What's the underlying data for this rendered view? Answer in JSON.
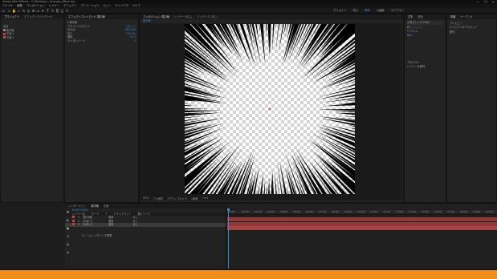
{
  "window": {
    "title": "Adobe After Effects - C:\\Desktop\\...\\manga_effect.aep",
    "controls": [
      "—",
      "❐",
      "✕"
    ]
  },
  "menu": [
    "ファイル",
    "編集",
    "コンポジション",
    "レイヤー",
    "エフェクト",
    "アニメーション",
    "ビュー",
    "ウィンドウ",
    "ヘルプ"
  ],
  "toolbar": {
    "workspaces": [
      "デフォルト",
      "学ぶ",
      "標準",
      "小画面",
      "ライブラリ"
    ],
    "active_workspace": "標準"
  },
  "project_panel": {
    "tabs": [
      "プロジェクト",
      "エフェクトコントロール"
    ],
    "items": [
      "名前",
      "集中線",
      "平面 1",
      "平面 2"
    ]
  },
  "effect_panel": {
    "tabs": [
      "エフェクトコントロール 集中線"
    ],
    "rows": [
      {
        "label": "集中線",
        "value": ""
      },
      {
        "label": "ブラインドカウント",
        "value": "リセット"
      },
      {
        "label": "中心点",
        "value": "960,540"
      },
      {
        "label": "長さ",
        "value": "100.0%"
      },
      {
        "label": "線幅",
        "value": "50.0"
      },
      {
        "label": "ランダムシード",
        "value": "0"
      }
    ]
  },
  "comp_panel": {
    "tabs": [
      "コンポジション 集中線",
      "レイヤー (なし)",
      "フッテージ (なし)"
    ],
    "breadcrumb": "集中線",
    "viewer_bar": [
      "50%",
      "フル画質",
      "アクティブカメラ",
      "1画面",
      "+0.0"
    ]
  },
  "right_panel": {
    "tabs": [
      "情報",
      "オーディオ",
      "プレビュー",
      "エフェクト&プリセット",
      "文字",
      "段落",
      "整列"
    ],
    "font": "小塚ゴシック Pr6N",
    "style": "M",
    "size": "100 px",
    "tracking": "0",
    "properties_title": "プロパティ",
    "align_label": "レイヤーを整列"
  },
  "timeline": {
    "tabs": [
      "レンダーキュー",
      "集中線",
      "平面"
    ],
    "timecode": "0:00:00:00",
    "columns": [
      "レイヤー名",
      "モード",
      "T",
      "トラックマット",
      "親とリンク"
    ],
    "layers": [
      {
        "num": "1",
        "name": "[集中線]",
        "mode": "通常",
        "parent": "なし",
        "color": "#c1443f"
      },
      {
        "num": "2",
        "name": "[平面 1]",
        "mode": "通常",
        "parent": "なし",
        "color": "#c1443f"
      },
      {
        "num": "3",
        "name": "[平面 2]",
        "mode": "通常",
        "parent": "なし",
        "color": "#c1443f"
      }
    ],
    "ruler_ticks": [
      "0:00f",
      "01:00f",
      "02:00f",
      "03:00f",
      "04:00f",
      "05:00f",
      "06:00f",
      "07:00f",
      "08:00f",
      "09:00f",
      "10:00f",
      "11:00f",
      "12:00f",
      "13:00f",
      "14:00f",
      "15:00f",
      "16:00f",
      "17:00f",
      "18:00f",
      "19:00f",
      "20:00f"
    ],
    "footer": "フレームレンダリング時間"
  },
  "colors": {
    "accent": "#3a86d1",
    "layer_bar": "#9c3a3a",
    "taskbar": "#f28c1b"
  }
}
